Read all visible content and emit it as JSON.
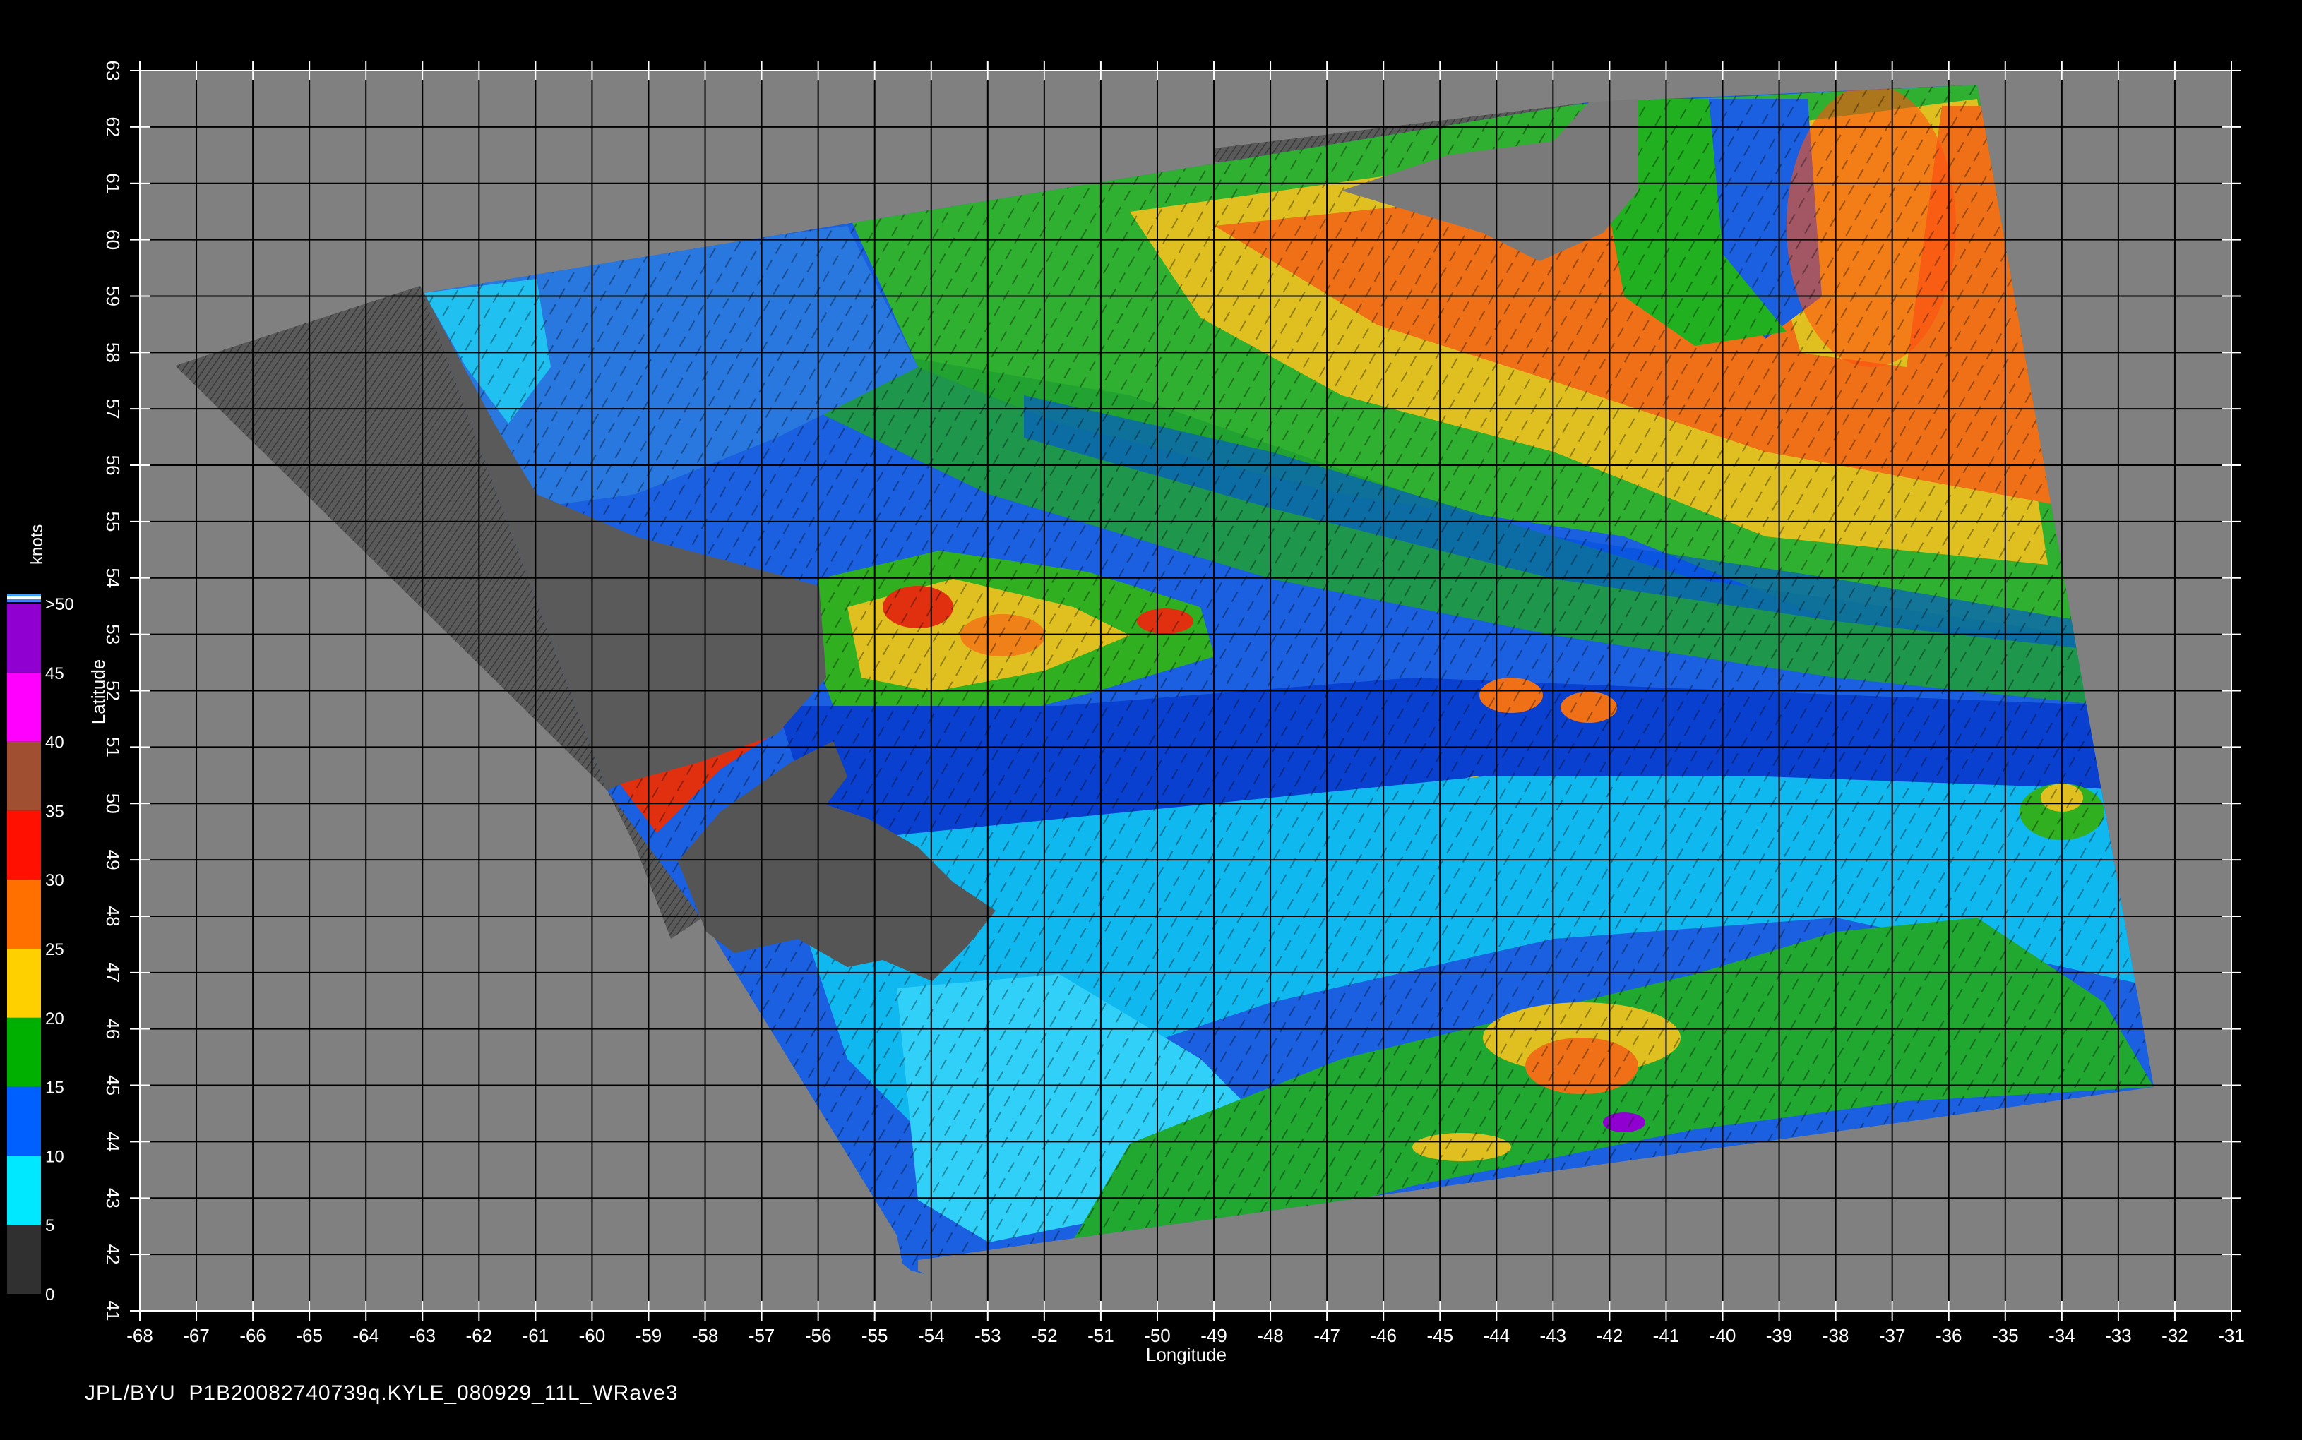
{
  "map": {
    "x_axis_title": "Longitude",
    "y_axis_title": "Latitude",
    "lon_ticks": [
      "-68",
      "-67",
      "-66",
      "-65",
      "-64",
      "-63",
      "-62",
      "-61",
      "-60",
      "-59",
      "-58",
      "-57",
      "-56",
      "-55",
      "-54",
      "-53",
      "-52",
      "-51",
      "-50",
      "-49",
      "-48",
      "-47",
      "-46",
      "-45",
      "-44",
      "-43",
      "-42",
      "-41",
      "-40",
      "-39",
      "-38",
      "-37",
      "-36",
      "-35",
      "-34",
      "-33",
      "-32",
      "-31"
    ],
    "lat_ticks": [
      "41",
      "42",
      "43",
      "44",
      "45",
      "46",
      "47",
      "48",
      "49",
      "50",
      "51",
      "52",
      "53",
      "54",
      "55",
      "56",
      "57",
      "58",
      "59",
      "60",
      "61",
      "62",
      "63"
    ],
    "lon_range": [
      -68,
      -31
    ],
    "lat_range": [
      41,
      63
    ],
    "grid": true,
    "land_color": "#555555",
    "background_color": "#808080",
    "outer_background": "#000000"
  },
  "colorbar": {
    "title": "knots",
    "labels": [
      ">50",
      "45",
      "40",
      "35",
      "30",
      "25",
      "20",
      "15",
      "10",
      "5",
      "0"
    ],
    "bands": [
      {
        "from": 0,
        "to": 5,
        "color": "#303030"
      },
      {
        "from": 5,
        "to": 10,
        "color": "#00e8ff"
      },
      {
        "from": 10,
        "to": 15,
        "color": "#0060ff"
      },
      {
        "from": 15,
        "to": 20,
        "color": "#00b000"
      },
      {
        "from": 20,
        "to": 25,
        "color": "#ffd000"
      },
      {
        "from": 25,
        "to": 30,
        "color": "#ff7000"
      },
      {
        "from": 30,
        "to": 35,
        "color": "#ff1000"
      },
      {
        "from": 35,
        "to": 40,
        "color": "#a05030"
      },
      {
        "from": 40,
        "to": 45,
        "color": "#ff00ff"
      },
      {
        "from": 45,
        "to": 50,
        "color": "#9000d0"
      }
    ]
  },
  "footer": {
    "text": "JPL/BYU  P1B20082740739q.KYLE_080929_11L_WRave3"
  }
}
